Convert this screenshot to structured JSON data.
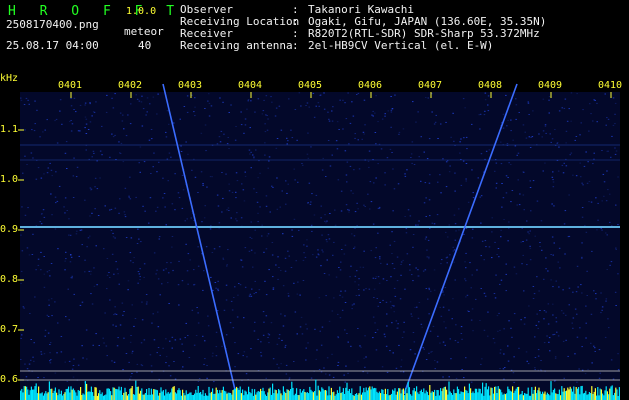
{
  "header": {
    "app_name": "H R O F F T",
    "version": "1.0.0",
    "filename": "2508170400.png",
    "datetime": "25.08.17 04:00",
    "meteor_label": "meteor",
    "meteor_count": "40"
  },
  "info": [
    {
      "label": "Observer",
      "value": "Takanori Kawachi"
    },
    {
      "label": "Receiving Location",
      "value": "Ogaki, Gifu, JAPAN (136.60E, 35.35N)"
    },
    {
      "label": "Receiver",
      "value": "R820T2(RTL-SDR) SDR-Sharp 53.372MHz"
    },
    {
      "label": "Receiving antenna",
      "value": "2el-HB9CV Vertical (el. E-W)"
    }
  ],
  "separator": ":",
  "axis": {
    "unit": "kHz",
    "x_ticks": [
      "0401",
      "0402",
      "0403",
      "0404",
      "0405",
      "0406",
      "0407",
      "0408",
      "0409",
      "0410"
    ],
    "y_ticks": [
      "1.1",
      "1.0",
      "0.9",
      "0.8",
      "0.7",
      "0.6"
    ],
    "y_tick_values": [
      1.1,
      1.0,
      0.9,
      0.8,
      0.7,
      0.6
    ]
  },
  "colors": {
    "title": "#22ff22",
    "accent": "#ffff33",
    "text": "#f2f2f2",
    "signal": "#1a3aff",
    "baseline": "#00e5ff"
  }
}
